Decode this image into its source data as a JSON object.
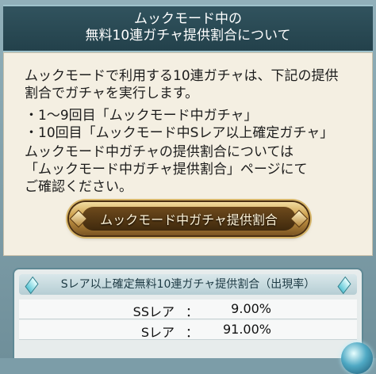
{
  "header": {
    "line1": "ムックモード中の",
    "line2": "無料10連ガチャ提供割合について"
  },
  "body": {
    "intro_line1": "ムックモードで利用する10連ガチャは、下記の提供",
    "intro_line2": "割合でガチャを実行します。",
    "bullet1": "・1〜9回目「ムックモード中ガチャ」",
    "bullet2": "・10回目「ムックモード中Sレア以上確定ガチャ」",
    "note_line1": "ムックモード中ガチャの提供割合については",
    "note_line2": "「ムックモード中ガチャ提供割合」ページにて",
    "note_line3": "ご確認ください。"
  },
  "button": {
    "label": "ムックモード中ガチャ提供割合"
  },
  "rates": {
    "title": "Sレア以上確定無料10連ガチャ提供割合（出現率）",
    "rows": [
      {
        "name": "SSレア",
        "colon": "：",
        "value": "9.00%"
      },
      {
        "name": "Sレア",
        "colon": "：",
        "value": "91.00%"
      }
    ]
  },
  "colors": {
    "header_bg": "#2b4a55",
    "panel_bg": "#f4efe2",
    "frame_bg": "#7c9da8",
    "button_gold": "#c99a45"
  },
  "icons": [
    "diamond-gem-icon",
    "crystal-orb-icon"
  ]
}
